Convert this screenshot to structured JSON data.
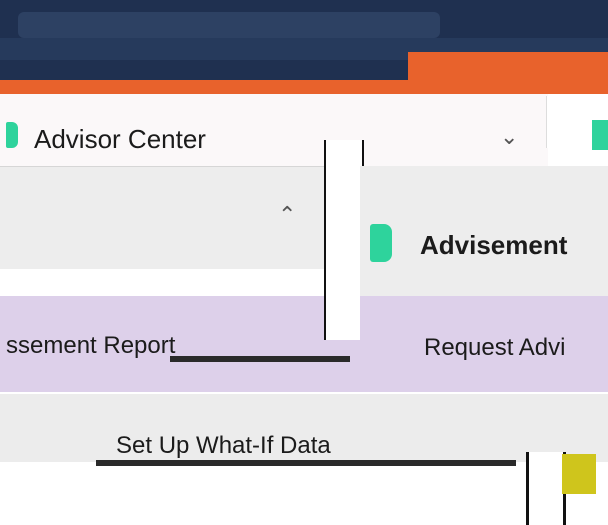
{
  "left_panel": {
    "title": "Advisor Center",
    "dropdown_icon": "chevron-down-icon",
    "section_chevron": "chevron-up-icon",
    "item_label": "ssement Report",
    "subitem_label": "Set Up What-If Data"
  },
  "right_panel": {
    "title": "Advisement",
    "item_label": "Request Advi"
  },
  "colors": {
    "navy": "#1f3050",
    "orange": "#e8622c",
    "green": "#2ed39c",
    "lavender": "#ddd0ea",
    "yellow": "#cfc51c"
  }
}
